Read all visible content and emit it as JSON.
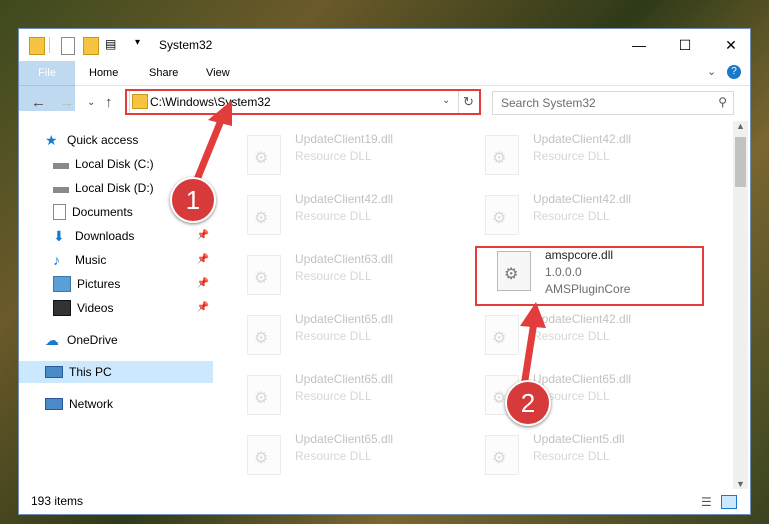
{
  "window": {
    "title": "System32"
  },
  "ribbon": {
    "tabs": [
      "File",
      "Home",
      "Share",
      "View"
    ]
  },
  "address": {
    "path": "C:\\Windows\\System32",
    "search_placeholder": "Search System32"
  },
  "nav": {
    "items": [
      {
        "label": "Quick access"
      },
      {
        "label": "Local Disk (C:)"
      },
      {
        "label": "Local Disk (D:)"
      },
      {
        "label": "Documents"
      },
      {
        "label": "Downloads"
      },
      {
        "label": "Music"
      },
      {
        "label": "Pictures"
      },
      {
        "label": "Videos"
      },
      {
        "label": "OneDrive"
      },
      {
        "label": "This PC"
      },
      {
        "label": "Network"
      }
    ]
  },
  "files": [
    {
      "name": "UpdateClient19.dll",
      "desc": "Resource DLL"
    },
    {
      "name": "UpdateClient42.dll",
      "desc": "Resource DLL"
    },
    {
      "name": "UpdateClient42.dll",
      "desc": "Resource DLL"
    },
    {
      "name": "UpdateClient42.dll",
      "desc": "Resource DLL"
    },
    {
      "name": "UpdateClient63.dll",
      "desc": "Resource DLL"
    },
    {
      "name": "amspcore.dll",
      "version": "1.0.0.0",
      "desc": "AMSPluginCore"
    },
    {
      "name": "UpdateClient65.dll",
      "desc": "Resource DLL"
    },
    {
      "name": "UpdateClient42.dll",
      "desc": "Resource DLL"
    },
    {
      "name": "UpdateClient65.dll",
      "desc": "Resource DLL"
    },
    {
      "name": "UpdateClient65.dll",
      "desc": "Resource DLL"
    },
    {
      "name": "UpdateClient65.dll",
      "desc": "Resource DLL"
    },
    {
      "name": "UpdateClient5.dll",
      "desc": "Resource DLL"
    }
  ],
  "status": {
    "count": "193 items"
  },
  "annotations": {
    "badge1": "1",
    "badge2": "2"
  },
  "colors": {
    "accent": "#1979ca",
    "highlight": "#e33c3c",
    "selected_nav": "#cce8ff"
  }
}
